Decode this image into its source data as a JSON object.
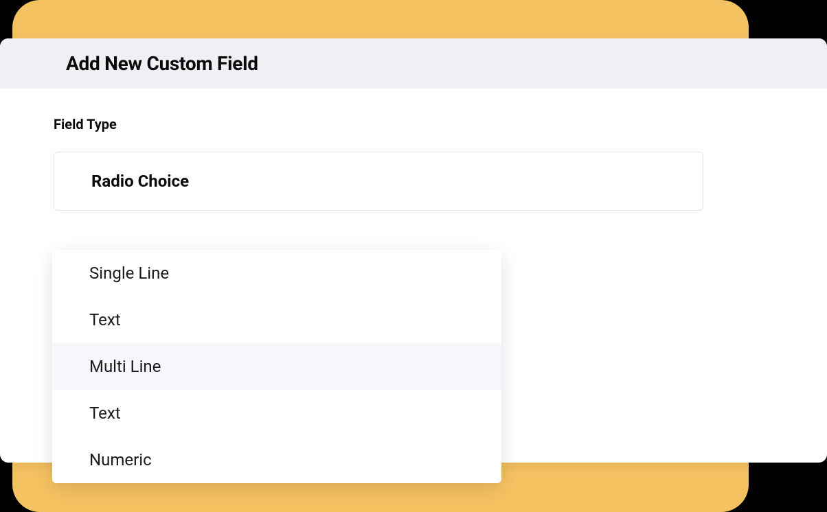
{
  "header": {
    "title": "Add New  Custom Field"
  },
  "form": {
    "field_type_label": "Field Type"
  },
  "select": {
    "selected_value": "Radio Choice",
    "options": [
      {
        "label": "Single Line",
        "highlighted": false
      },
      {
        "label": "Text",
        "highlighted": false
      },
      {
        "label": "Multi Line",
        "highlighted": true
      },
      {
        "label": "Text",
        "highlighted": false
      },
      {
        "label": "Numeric",
        "highlighted": false
      }
    ]
  }
}
